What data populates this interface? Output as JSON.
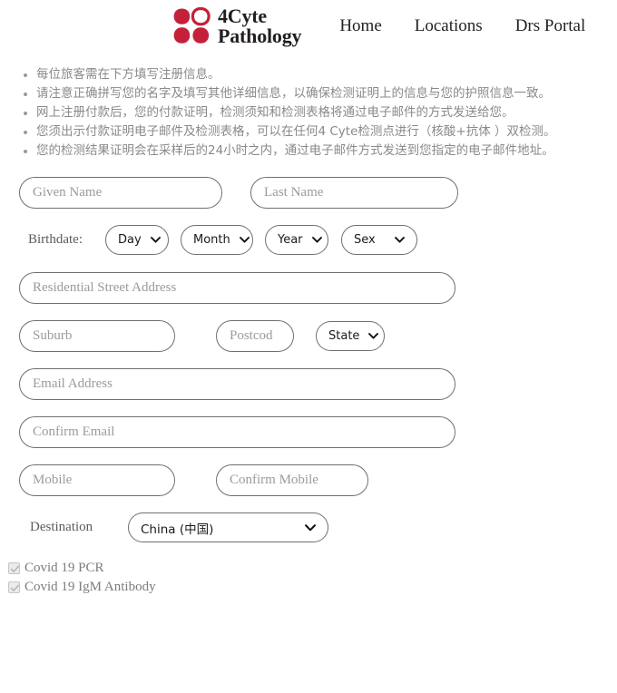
{
  "brand": {
    "logo_icon": "clover-logo-icon",
    "logo_color": "#c4203a",
    "line1": "4Cyte",
    "line2": "Pathology"
  },
  "nav": {
    "items": [
      {
        "label": "Home"
      },
      {
        "label": "Locations"
      },
      {
        "label": "Drs Portal"
      }
    ]
  },
  "notices": [
    {
      "text": "每位旅客需在下方填写注册信息。"
    },
    {
      "text": "请注意正确拼写您的名字及填写其他详细信息，以确保检测证明上的信息与您的护照信息一致。"
    },
    {
      "text": "网上注册付款后，您的付款证明，检测须知和检测表格将通过电子邮件的方式发送给您。"
    },
    {
      "text": "您须出示付款证明电子邮件及检测表格，可以在任何4 Cyte检测点进行（核酸+抗体 ）双检测。"
    },
    {
      "text": "您的检测结果证明会在采样后的24小时之内，通过电子邮件方式发送到您指定的电子邮件地址。"
    }
  ],
  "form": {
    "given_name": {
      "placeholder": "Given Name",
      "value": ""
    },
    "last_name": {
      "placeholder": "Last Name",
      "value": ""
    },
    "birthdate_label": "Birthdate:",
    "day_select": {
      "value": "Day"
    },
    "month_select": {
      "value": "Month"
    },
    "year_select": {
      "value": "Year"
    },
    "sex_select": {
      "value": "Sex"
    },
    "street_address": {
      "placeholder": "Residential Street Address",
      "value": ""
    },
    "suburb": {
      "placeholder": "Suburb",
      "value": ""
    },
    "postcode": {
      "placeholder": "Postcod",
      "value": ""
    },
    "state_select": {
      "value": "State"
    },
    "email": {
      "placeholder": "Email Address",
      "value": ""
    },
    "confirm_email": {
      "placeholder": "Confirm Email",
      "value": ""
    },
    "mobile": {
      "placeholder": "Mobile",
      "value": ""
    },
    "confirm_mobile": {
      "placeholder": "Confirm Mobile",
      "value": ""
    },
    "destination_label": "Destination",
    "destination_select": {
      "value": "China (中国)"
    }
  },
  "tests": [
    {
      "label": "Covid 19 PCR",
      "checked": true,
      "disabled": true
    },
    {
      "label": "Covid 19 IgM Antibody",
      "checked": true,
      "disabled": true
    }
  ]
}
